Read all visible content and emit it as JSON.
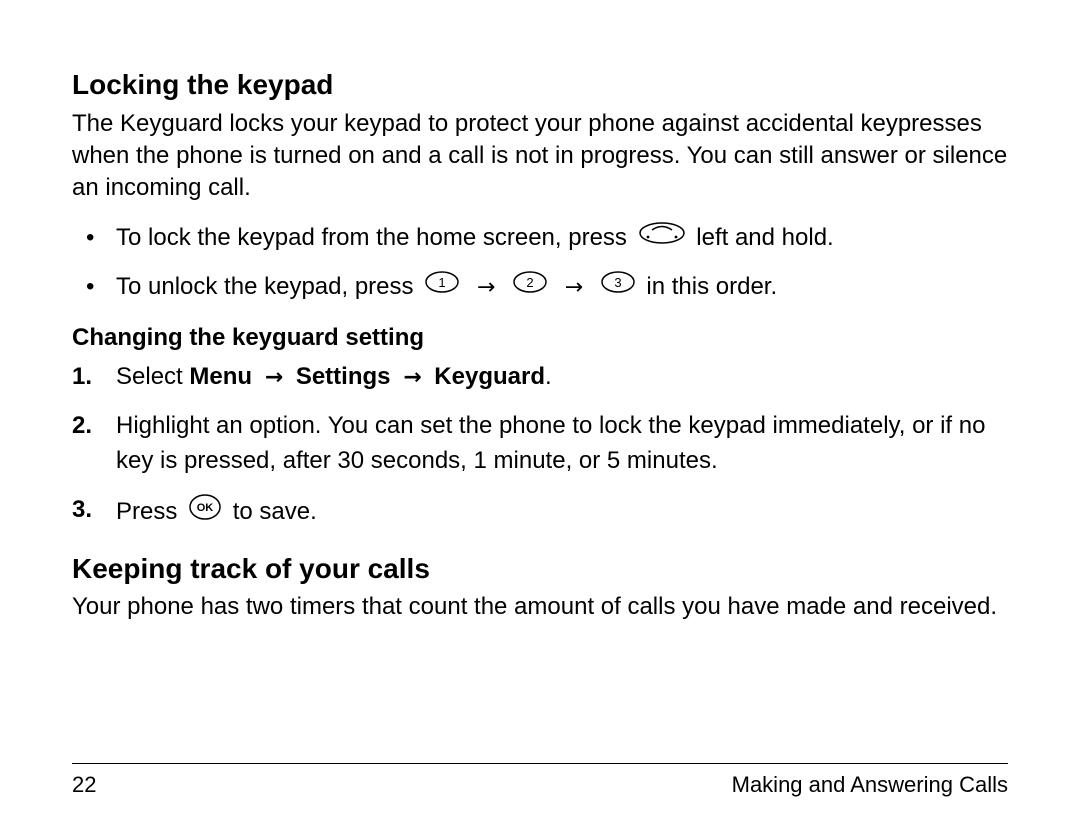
{
  "section1": {
    "heading": "Locking the keypad",
    "intro": "The Keyguard locks your keypad to protect your phone against accidental keypresses when the phone is turned on and a call is not in progress. You can still answer or silence an incoming call.",
    "bullet1_pre": "To lock the keypad from the home screen, press ",
    "bullet1_post": " left and hold.",
    "bullet2_pre": "To unlock the keypad, press ",
    "bullet2_post": " in this order.",
    "arrow": "→",
    "subheading": "Changing the keyguard setting",
    "step1_pre": "Select ",
    "step1_menu": "Menu",
    "step1_settings": "Settings",
    "step1_keyguard": "Keyguard",
    "step1_period": ".",
    "step2": "Highlight an option. You can set the phone to lock the keypad immediately, or if no key is pressed, after 30 seconds, 1 minute, or 5 minutes.",
    "step3_pre": "Press ",
    "step3_post": " to save.",
    "num1": "1.",
    "num2": "2.",
    "num3": "3."
  },
  "section2": {
    "heading": "Keeping track of your calls",
    "intro": "Your phone has two timers that count the amount of calls you have made and received."
  },
  "footer": {
    "page": "22",
    "title": "Making and Answering Calls"
  },
  "icons": {
    "nav": "nav-key-icon",
    "key1": "key-1-icon",
    "key2": "key-2-icon",
    "key3": "key-3-icon",
    "ok": "ok-key-icon"
  }
}
